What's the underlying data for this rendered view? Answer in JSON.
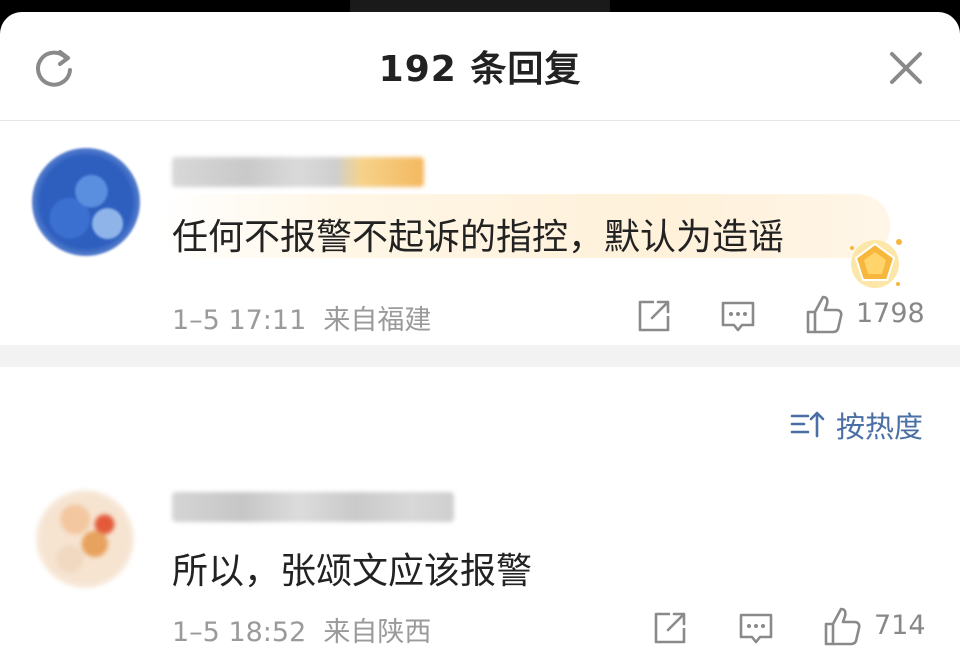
{
  "header": {
    "title": "192 条回复",
    "refresh_icon": "refresh-icon",
    "close_icon": "close-icon"
  },
  "pinned_comment": {
    "text": "任何不报警不起诉的指控，默认为造谣",
    "time": "1–5 17:11",
    "location": "来自福建",
    "likes": "1798",
    "badge_icon": "gold-badge-icon"
  },
  "sort": {
    "label": "按热度",
    "icon": "sort-icon"
  },
  "replies": [
    {
      "text": "所以，张颂文应该报警",
      "time": "1–5 18:52",
      "location": "来自陕西",
      "likes": "714"
    }
  ],
  "colors": {
    "accent_blue": "#4a6fa5",
    "meta_gray": "#9a9a9a",
    "text_dark": "#222222",
    "highlight": "#fff1da",
    "badge_gold": "#f6b73c"
  }
}
